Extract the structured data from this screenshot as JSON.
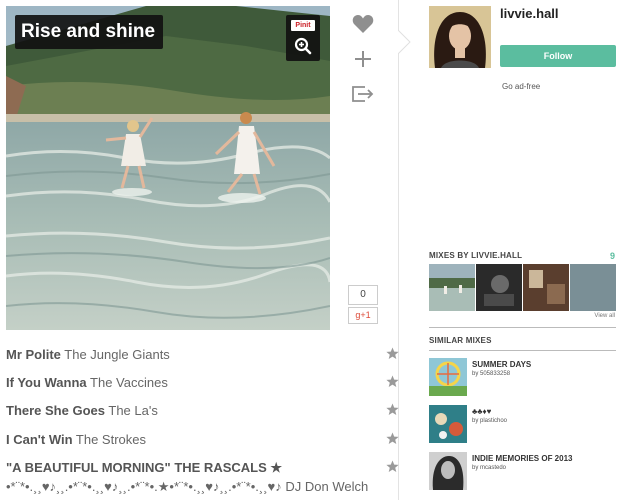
{
  "mix": {
    "title": "Rise and shine",
    "pin_label": "Pinit",
    "like_count": "0",
    "gplus_label": "g+1"
  },
  "user": {
    "name": "livvie.hall",
    "follow_label": "Follow",
    "adfree_label": "Go ad-free"
  },
  "mixes_by": {
    "label": "MIXES BY LIVVIE.HALL",
    "count": "9",
    "view_all": "View all"
  },
  "similar": {
    "label": "SIMILAR MIXES",
    "items": [
      {
        "title": "SUMMER DAYS",
        "by": "by 505833258"
      },
      {
        "title": "♣♣♦♥",
        "by": "by plastichoo"
      },
      {
        "title": "INDIE MEMORIES OF 2013",
        "by": "by mcastedo"
      }
    ]
  },
  "tracks": [
    {
      "title": "Mr Polite",
      "artist": "The Jungle Giants"
    },
    {
      "title": "If You Wanna",
      "artist": "The Vaccines"
    },
    {
      "title": "There She Goes",
      "artist": "The La's"
    },
    {
      "title": "I Can't Win",
      "artist": "The Strokes"
    },
    {
      "title": "\"A BEAUTIFUL MORNING\" THE RASCALS ★",
      "artist": ""
    }
  ],
  "track_extra": "•*¨*•.¸¸♥♪¸¸.•*¨*•.¸¸♥♪¸¸.•*¨*•.★•*¨*•.¸¸♥♪¸¸.•*¨*•.¸¸♥♪ DJ Don Welch",
  "colors": {
    "accent": "#5bbd9f",
    "title_bg": "#111111",
    "star": "#9a9a9a"
  }
}
